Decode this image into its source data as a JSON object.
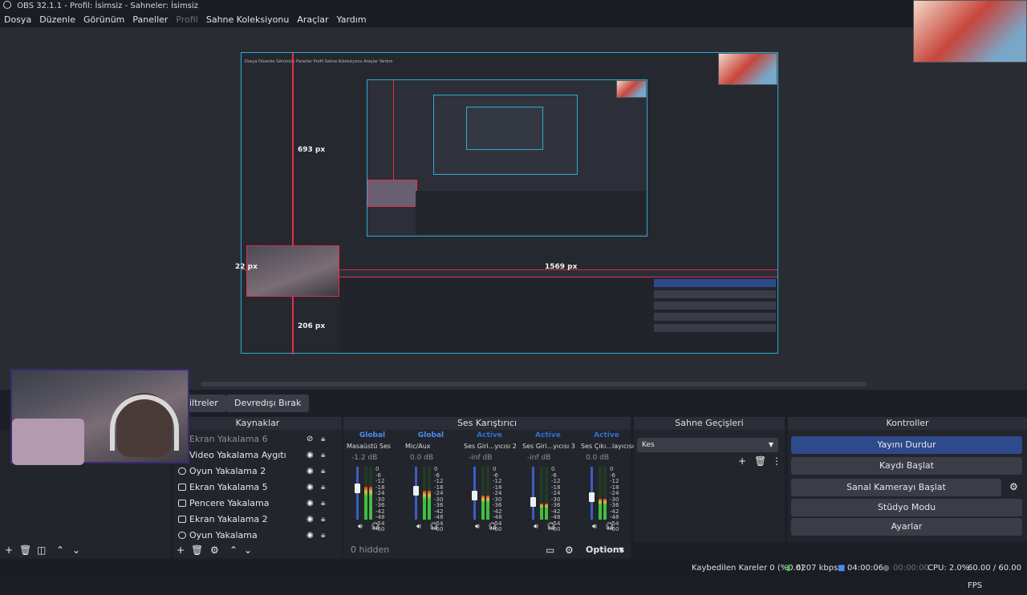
{
  "window": {
    "title": "OBS 32.1.1 - Profil: İsimsiz - Sahneler: İsimsiz"
  },
  "menu": [
    "Dosya",
    "Düzenle",
    "Görünüm",
    "Paneller",
    "Profil",
    "Sahne Koleksiyonu",
    "Araçlar",
    "Yardım"
  ],
  "preview": {
    "label_693": "693 px",
    "label_22": "22 px",
    "label_1569": "1569 px",
    "label_206": "206 px"
  },
  "toolbar": {
    "filters_label": "iltreler",
    "deactivate_label": "Devredışı Bırak"
  },
  "docks": {
    "sources_title": "Kaynaklar",
    "mixer_title": "Ses Karıştırıcı",
    "transitions_title": "Sahne Geçişleri",
    "controls_title": "Kontroller"
  },
  "sources": [
    {
      "name": "Ekran Yakalama 6",
      "icon": "monitor-icon",
      "visible": false
    },
    {
      "name": "Video Yakalama Aygıtı",
      "icon": "camera-icon",
      "visible": true
    },
    {
      "name": "Oyun Yakalama 2",
      "icon": "gamepad-icon",
      "visible": true
    },
    {
      "name": "Ekran Yakalama 5",
      "icon": "monitor-icon",
      "visible": true
    },
    {
      "name": "Pencere Yakalama",
      "icon": "window-icon",
      "visible": true
    },
    {
      "name": "Ekran Yakalama 2",
      "icon": "monitor-icon",
      "visible": true
    },
    {
      "name": "Oyun Yakalama",
      "icon": "gamepad-icon",
      "visible": true
    }
  ],
  "mixer": {
    "strips": [
      {
        "status": "Global",
        "name": "Masaüstü Ses",
        "db": "-1.2 dB",
        "level": 0.62,
        "color": "#4a8cf0"
      },
      {
        "status": "Global",
        "name": "Mic/Aux",
        "db": "0.0 dB",
        "level": 0.55,
        "color": "#4a8cf0"
      },
      {
        "status": "Active",
        "name": "Ses Giri...yıcısı 2",
        "db": "-inf dB",
        "level": 0.45,
        "color": "#2f6fd0"
      },
      {
        "status": "Active",
        "name": "Ses Giri...yıcısı 3",
        "db": "-inf dB",
        "level": 0.3,
        "color": "#2f6fd0"
      },
      {
        "status": "Active",
        "name": "Ses Çıkı...layıcısı",
        "db": "0.0 dB",
        "level": 0.4,
        "color": "#2f6fd0"
      }
    ],
    "scale": "0\n-6\n-12\n-18\n-24\n-30\n-36\n-42\n-48\n-54\n-60",
    "hidden_label": "0 hidden",
    "options_label": "Options"
  },
  "transitions": {
    "selected": "Kes"
  },
  "controls": {
    "stop_stream": "Yayını Durdur",
    "start_recording": "Kaydı Başlat",
    "start_virtualcam": "Sanal Kamerayı Başlat",
    "studio_mode": "Stüdyo Modu",
    "settings": "Ayarlar"
  },
  "status": {
    "dropped_frames": "Kaybedilen Kareler 0 (%0.0)",
    "bitrate": "6207 kbps",
    "stream_time": "04:00:06",
    "record_time": "00:00:00",
    "cpu": "CPU: 2.0%",
    "fps": "60.00 / 60.00 FPS"
  }
}
